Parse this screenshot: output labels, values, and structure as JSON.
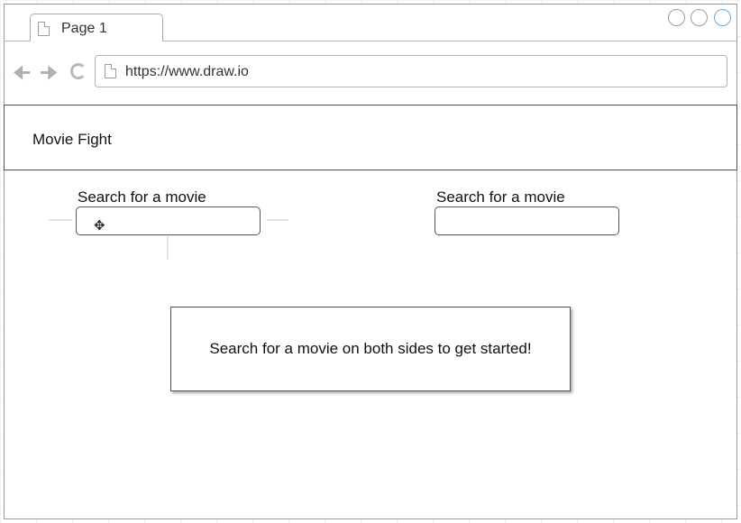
{
  "browser": {
    "tab_label": "Page 1",
    "url": "https://www.draw.io",
    "icons": [
      "back-arrow-icon",
      "forward-arrow-icon",
      "reload-icon",
      "page-icon"
    ]
  },
  "app": {
    "title": "Movie Fight"
  },
  "search": {
    "left_label": "Search for a movie",
    "right_label": "Search for a movie",
    "left_value": "",
    "right_value": ""
  },
  "message": {
    "text": "Search for a movie on both sides to get started!"
  },
  "colors": {
    "border_dark": "#555555",
    "chrome_gray": "#b0b0b0",
    "active_window_ctrl": "#6fa8d8"
  }
}
